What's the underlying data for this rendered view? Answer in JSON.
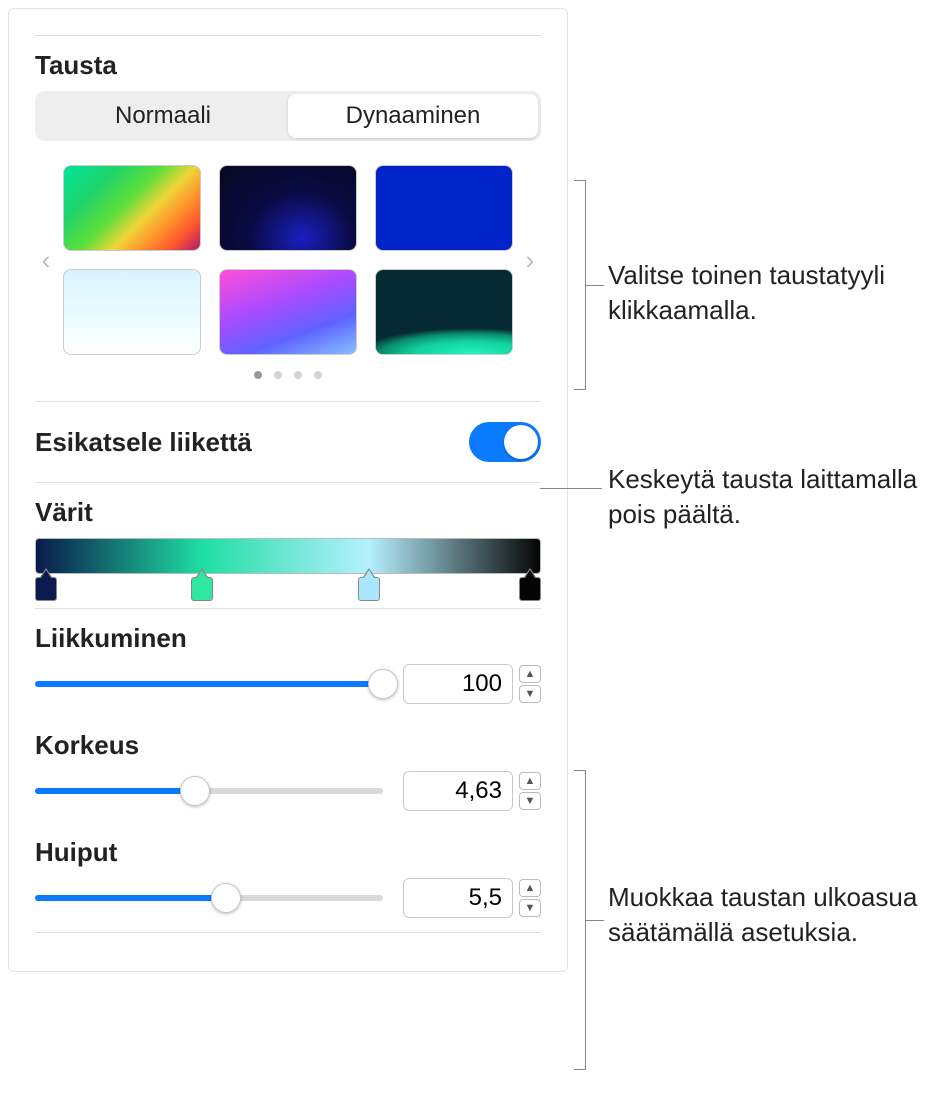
{
  "section": {
    "title": "Tausta"
  },
  "segmented": {
    "normal": "Normaali",
    "dynamic": "Dynaaminen",
    "active": "dynamic"
  },
  "gallery": {
    "page_count": 4,
    "active_page": 0
  },
  "preview_motion": {
    "label": "Esikatsele liikettä",
    "on": true
  },
  "colors": {
    "label": "Värit",
    "stops": [
      {
        "pos": 0,
        "color": "#0a1a4a"
      },
      {
        "pos": 33,
        "color": "#2fe79e"
      },
      {
        "pos": 66,
        "color": "#a9e7ff"
      },
      {
        "pos": 100,
        "color": "#050505"
      }
    ]
  },
  "sliders": {
    "movement": {
      "label": "Liikkuminen",
      "value": "100",
      "percent": 100
    },
    "height": {
      "label": "Korkeus",
      "value": "4,63",
      "percent": 46
    },
    "peaks": {
      "label": "Huiput",
      "value": "5,5",
      "percent": 55
    }
  },
  "callouts": {
    "gallery": "Valitse toinen taustatyyli klikkaamalla.",
    "toggle": "Keskeytä tausta laittamalla pois päältä.",
    "sliders": "Muokkaa taustan ulkoasua säätämällä asetuksia."
  }
}
